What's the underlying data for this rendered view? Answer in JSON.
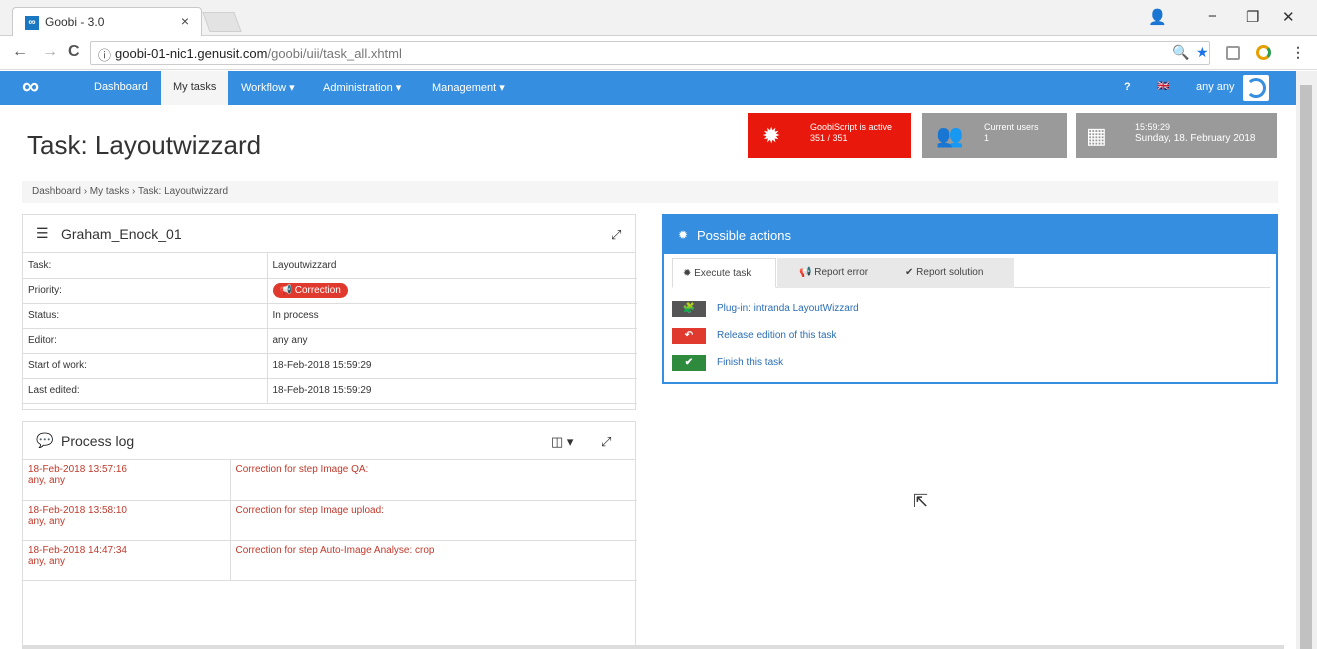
{
  "browser": {
    "tab_title": "Goobi - 3.0",
    "tab_close": "×",
    "favicon_text": "∞",
    "url_host": "goobi-01-nic1.genusit.com",
    "url_path": "/goobi/uii/task_all.xhtml",
    "back": "←",
    "forward": "→",
    "reload": "C",
    "info": "ⓘ",
    "account": "👤",
    "minimize": "−",
    "restore": "❐",
    "close": "✕",
    "zoom": "🔍",
    "star": "★",
    "menu": "⋮"
  },
  "navbar": {
    "logo": "∞",
    "items": [
      {
        "label": "Dashboard"
      },
      {
        "label": "My tasks"
      },
      {
        "label": "Workflow ▾"
      },
      {
        "label": "Administration ▾"
      },
      {
        "label": "Management ▾"
      }
    ],
    "help": "?",
    "flag": "🇬🇧",
    "user": "any any"
  },
  "page": {
    "title": "Task: Layoutwizzard",
    "breadcrumb": "Dashboard › My tasks › Task: Layoutwizzard"
  },
  "info_boxes": {
    "script": {
      "line1": "GoobiScript is active",
      "line2": "351 / 351",
      "icon": "✹",
      "color": "#e8180c"
    },
    "users": {
      "line1": "Current users",
      "line2": "1",
      "icon": "👥",
      "color": "#9a9a9a"
    },
    "time": {
      "line1": "15:59:29",
      "line2": "Sunday, 18. February 2018",
      "icon": "▦",
      "color": "#9a9a9a"
    }
  },
  "details": {
    "title": "Graham_Enock_01",
    "icon": "☰",
    "expand": "⤢",
    "rows": [
      {
        "key": "Task:",
        "value": "Layoutwizzard"
      },
      {
        "key": "Priority:",
        "value": "Correction",
        "badge": true
      },
      {
        "key": "Status:",
        "value": "In process"
      },
      {
        "key": "Editor:",
        "value": "any any"
      },
      {
        "key": "Start of work:",
        "value": "18-Feb-2018 15:59:29"
      },
      {
        "key": "Last edited:",
        "value": "18-Feb-2018 15:59:29"
      }
    ]
  },
  "log": {
    "title": "Process log",
    "icon": "💬",
    "columns_icon": "◫ ▾",
    "expand": "⤢",
    "entries": [
      {
        "date": "18-Feb-2018 13:57:16",
        "user": "any, any",
        "text": "Correction for step Image QA:"
      },
      {
        "date": "18-Feb-2018 13:58:10",
        "user": "any, any",
        "text": "Correction for step Image upload:"
      },
      {
        "date": "18-Feb-2018 14:47:34",
        "user": "any, any",
        "text": "Correction for step Auto-Image Analyse: crop"
      }
    ]
  },
  "actions": {
    "title": "Possible actions",
    "icon": "✹",
    "tabs": [
      {
        "label": "Execute task",
        "icon": "✹"
      },
      {
        "label": "Report error",
        "icon": "📢"
      },
      {
        "label": "Report solution",
        "icon": "✔"
      }
    ],
    "items": [
      {
        "label": "Plug-in: intranda LayoutWizzard",
        "icon": "🧩",
        "color": "#555555"
      },
      {
        "label": "Release edition of this task",
        "icon": "↶",
        "color": "#e03a2e"
      },
      {
        "label": "Finish this task",
        "icon": "✔",
        "color": "#2e8b3e"
      }
    ]
  },
  "colors": {
    "accent": "#368ee0",
    "danger": "#e03a2e",
    "success": "#2e8b3e"
  }
}
